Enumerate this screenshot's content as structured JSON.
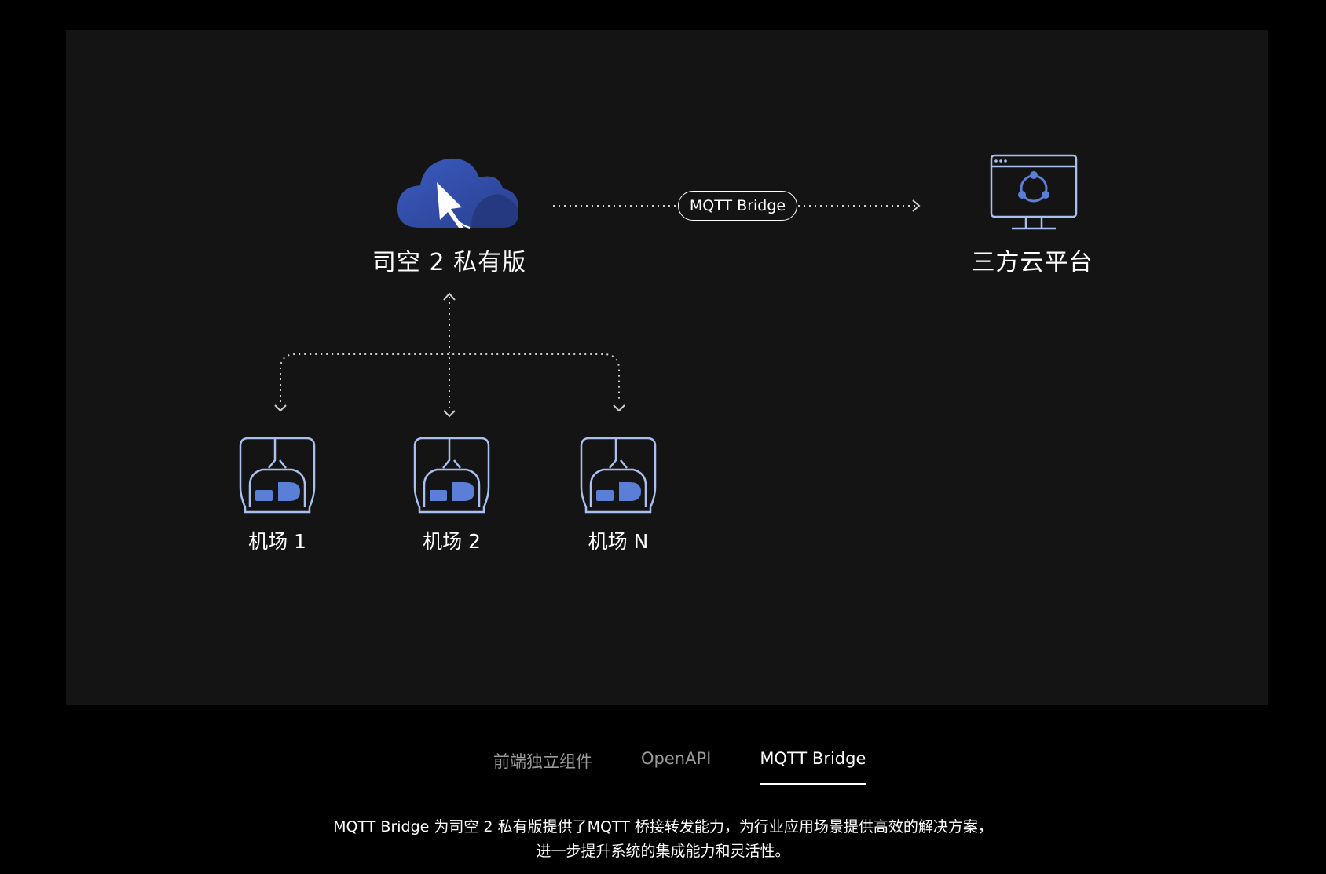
{
  "diagram": {
    "private_cloud_label": "司空 2 私有版",
    "third_party_label": "三方云平台",
    "bridge_label": "MQTT Bridge",
    "airports": [
      {
        "label": "机场 1"
      },
      {
        "label": "机场 2"
      },
      {
        "label": "机场 N"
      }
    ]
  },
  "tabs": [
    {
      "label": "前端独立组件",
      "active": false
    },
    {
      "label": "OpenAPI",
      "active": false
    },
    {
      "label": "MQTT Bridge",
      "active": true
    }
  ],
  "description": {
    "line1": "MQTT Bridge 为司空 2 私有版提供了MQTT 桥接转发能力，为行业应用场景提供高效的解决方案，",
    "line2": "进一步提升系统的集成能力和灵活性。"
  },
  "colors": {
    "background": "#000000",
    "panel": "#141414",
    "accent_blue": "#5b7fd6",
    "cloud_blue": "#3350a8",
    "icon_outline": "#a9bff0"
  }
}
